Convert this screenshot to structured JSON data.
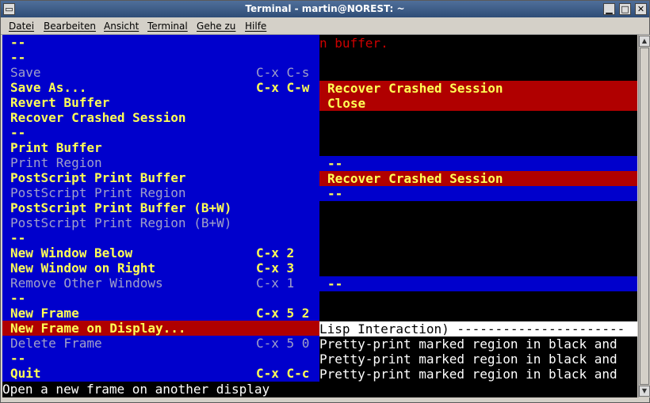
{
  "window": {
    "title": "Terminal - martin@NOREST: ~",
    "menu_glyph": "▭",
    "min_glyph": "▁",
    "max_glyph": "□",
    "close_glyph": "✕"
  },
  "menubar": [
    "Datei",
    "Bearbeiten",
    "Ansicht",
    "Terminal",
    "Gehe zu",
    "Hilfe"
  ],
  "emacs_menu": [
    {
      "label": "--",
      "key": "",
      "state": "sep"
    },
    {
      "label": "--",
      "key": "",
      "state": "sep"
    },
    {
      "label": "Save",
      "key": "C-x C-s",
      "state": "disabled"
    },
    {
      "label": "Save As...",
      "key": "C-x C-w",
      "state": "enabled"
    },
    {
      "label": "Revert Buffer",
      "key": "",
      "state": "enabled"
    },
    {
      "label": "Recover Crashed Session",
      "key": "",
      "state": "enabled"
    },
    {
      "label": "--",
      "key": "",
      "state": "sep"
    },
    {
      "label": "Print Buffer",
      "key": "",
      "state": "enabled"
    },
    {
      "label": "Print Region",
      "key": "",
      "state": "disabled"
    },
    {
      "label": "PostScript Print Buffer",
      "key": "",
      "state": "enabled"
    },
    {
      "label": "PostScript Print Region",
      "key": "",
      "state": "disabled"
    },
    {
      "label": "PostScript Print Buffer (B+W)",
      "key": "",
      "state": "enabled"
    },
    {
      "label": "PostScript Print Region (B+W)",
      "key": "",
      "state": "disabled"
    },
    {
      "label": "--",
      "key": "",
      "state": "sep"
    },
    {
      "label": "New Window Below",
      "key": "C-x 2",
      "state": "enabled"
    },
    {
      "label": "New Window on Right",
      "key": "C-x 3",
      "state": "enabled"
    },
    {
      "label": "Remove Other Windows",
      "key": "C-x 1",
      "state": "disabled"
    },
    {
      "label": "--",
      "key": "",
      "state": "sep"
    },
    {
      "label": "New Frame",
      "key": "C-x 5 2",
      "state": "enabled"
    },
    {
      "label": "New Frame on Display...",
      "key": "",
      "state": "selected"
    },
    {
      "label": "Delete Frame",
      "key": "C-x 5 0",
      "state": "disabled"
    },
    {
      "label": "--",
      "key": "",
      "state": "sep"
    },
    {
      "label": "Quit",
      "key": "C-x C-c",
      "state": "enabled"
    }
  ],
  "background": {
    "buffer_text": "n buffer.",
    "recover1": "Recover Crashed Session",
    "close": "Close",
    "dash1": "--",
    "recover2": "Recover Crashed Session",
    "dash2": "--",
    "dash3": "--",
    "modeline": "Lisp Interaction) ----------------------",
    "pretty1": "Pretty-print marked region in black and",
    "pretty2": "Pretty-print marked region in black and",
    "pretty3": "Pretty-print marked region in black and"
  },
  "echo_area": "Open a new frame on another display",
  "colors": {
    "menu_bg": "#0000cc",
    "menu_text": "#ffff55",
    "disabled_text": "#a0a0c8",
    "selected_bg": "#b00000",
    "terminal_bg": "#000000"
  }
}
